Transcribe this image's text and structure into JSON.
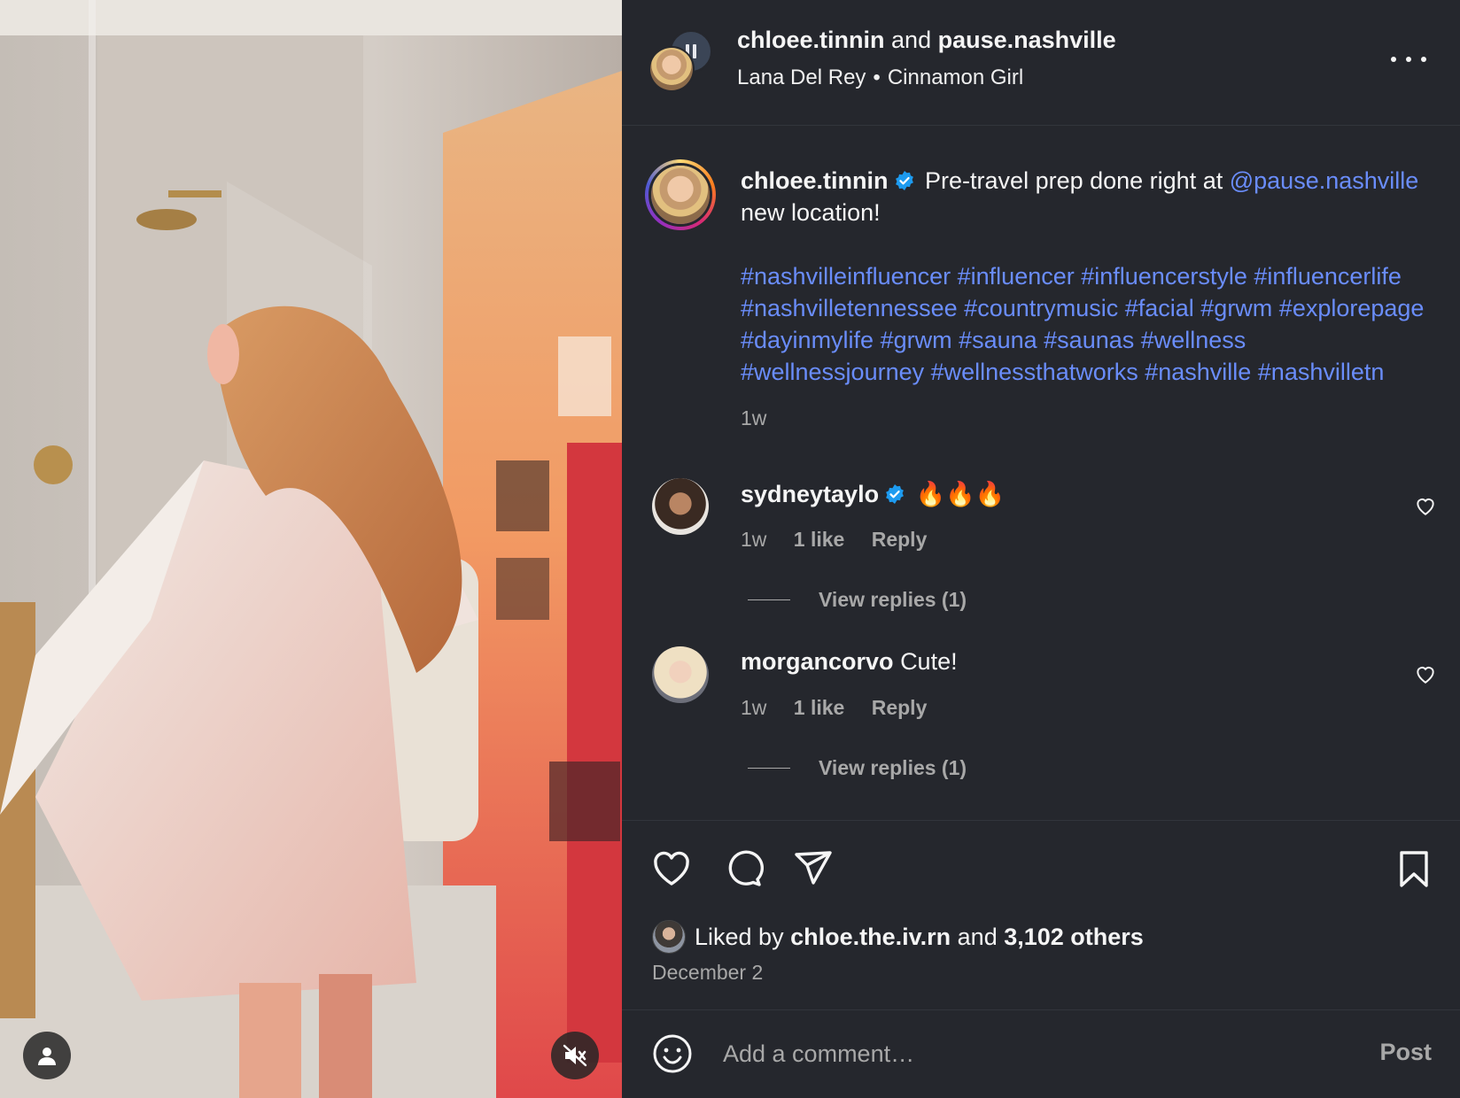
{
  "header": {
    "author": "chloee.tinnin",
    "conjunction": "and",
    "collaborator": "pause.nashville",
    "audio_artist": "Lana Del Rey",
    "audio_separator": "•",
    "audio_track": "Cinnamon Girl",
    "more_icon": "more-horizontal-icon"
  },
  "media": {
    "user_icon": "user-tag-icon",
    "mute_icon": "speaker-muted-icon"
  },
  "caption": {
    "username": "chloee.tinnin",
    "text_1": "Pre-travel prep done right at",
    "mention": "@pause.nashville",
    "text_2": "new location!",
    "hashtags": "#nashvilleinfluencer #influencer #influencerstyle #influencerlife #nashvilletennessee #countrymusic #facial #grwm #explorepage #dayinmylife #grwm #sauna #saunas #wellness #wellnessjourney #wellnessthatworks #nashville #nashvilletn",
    "time": "1w"
  },
  "comments": [
    {
      "username": "sydneytaylo",
      "verified": true,
      "text": "🔥🔥🔥",
      "time": "1w",
      "likes": "1 like",
      "reply": "Reply",
      "view_replies": "View replies (1)"
    },
    {
      "username": "morgancorvo",
      "verified": false,
      "text": "Cute!",
      "time": "1w",
      "likes": "1 like",
      "reply": "Reply",
      "view_replies": "View replies (1)"
    }
  ],
  "actions": {
    "liked_prefix": "Liked by",
    "liked_user": "chloe.the.iv.rn",
    "liked_and": "and",
    "liked_others": "3,102 others",
    "date": "December 2"
  },
  "composer": {
    "placeholder": "Add a comment…",
    "post_label": "Post"
  },
  "colors": {
    "background": "#25272d",
    "link": "#6a8dfb",
    "muted": "#a8a8a8",
    "verified": "#1d9bf0"
  }
}
